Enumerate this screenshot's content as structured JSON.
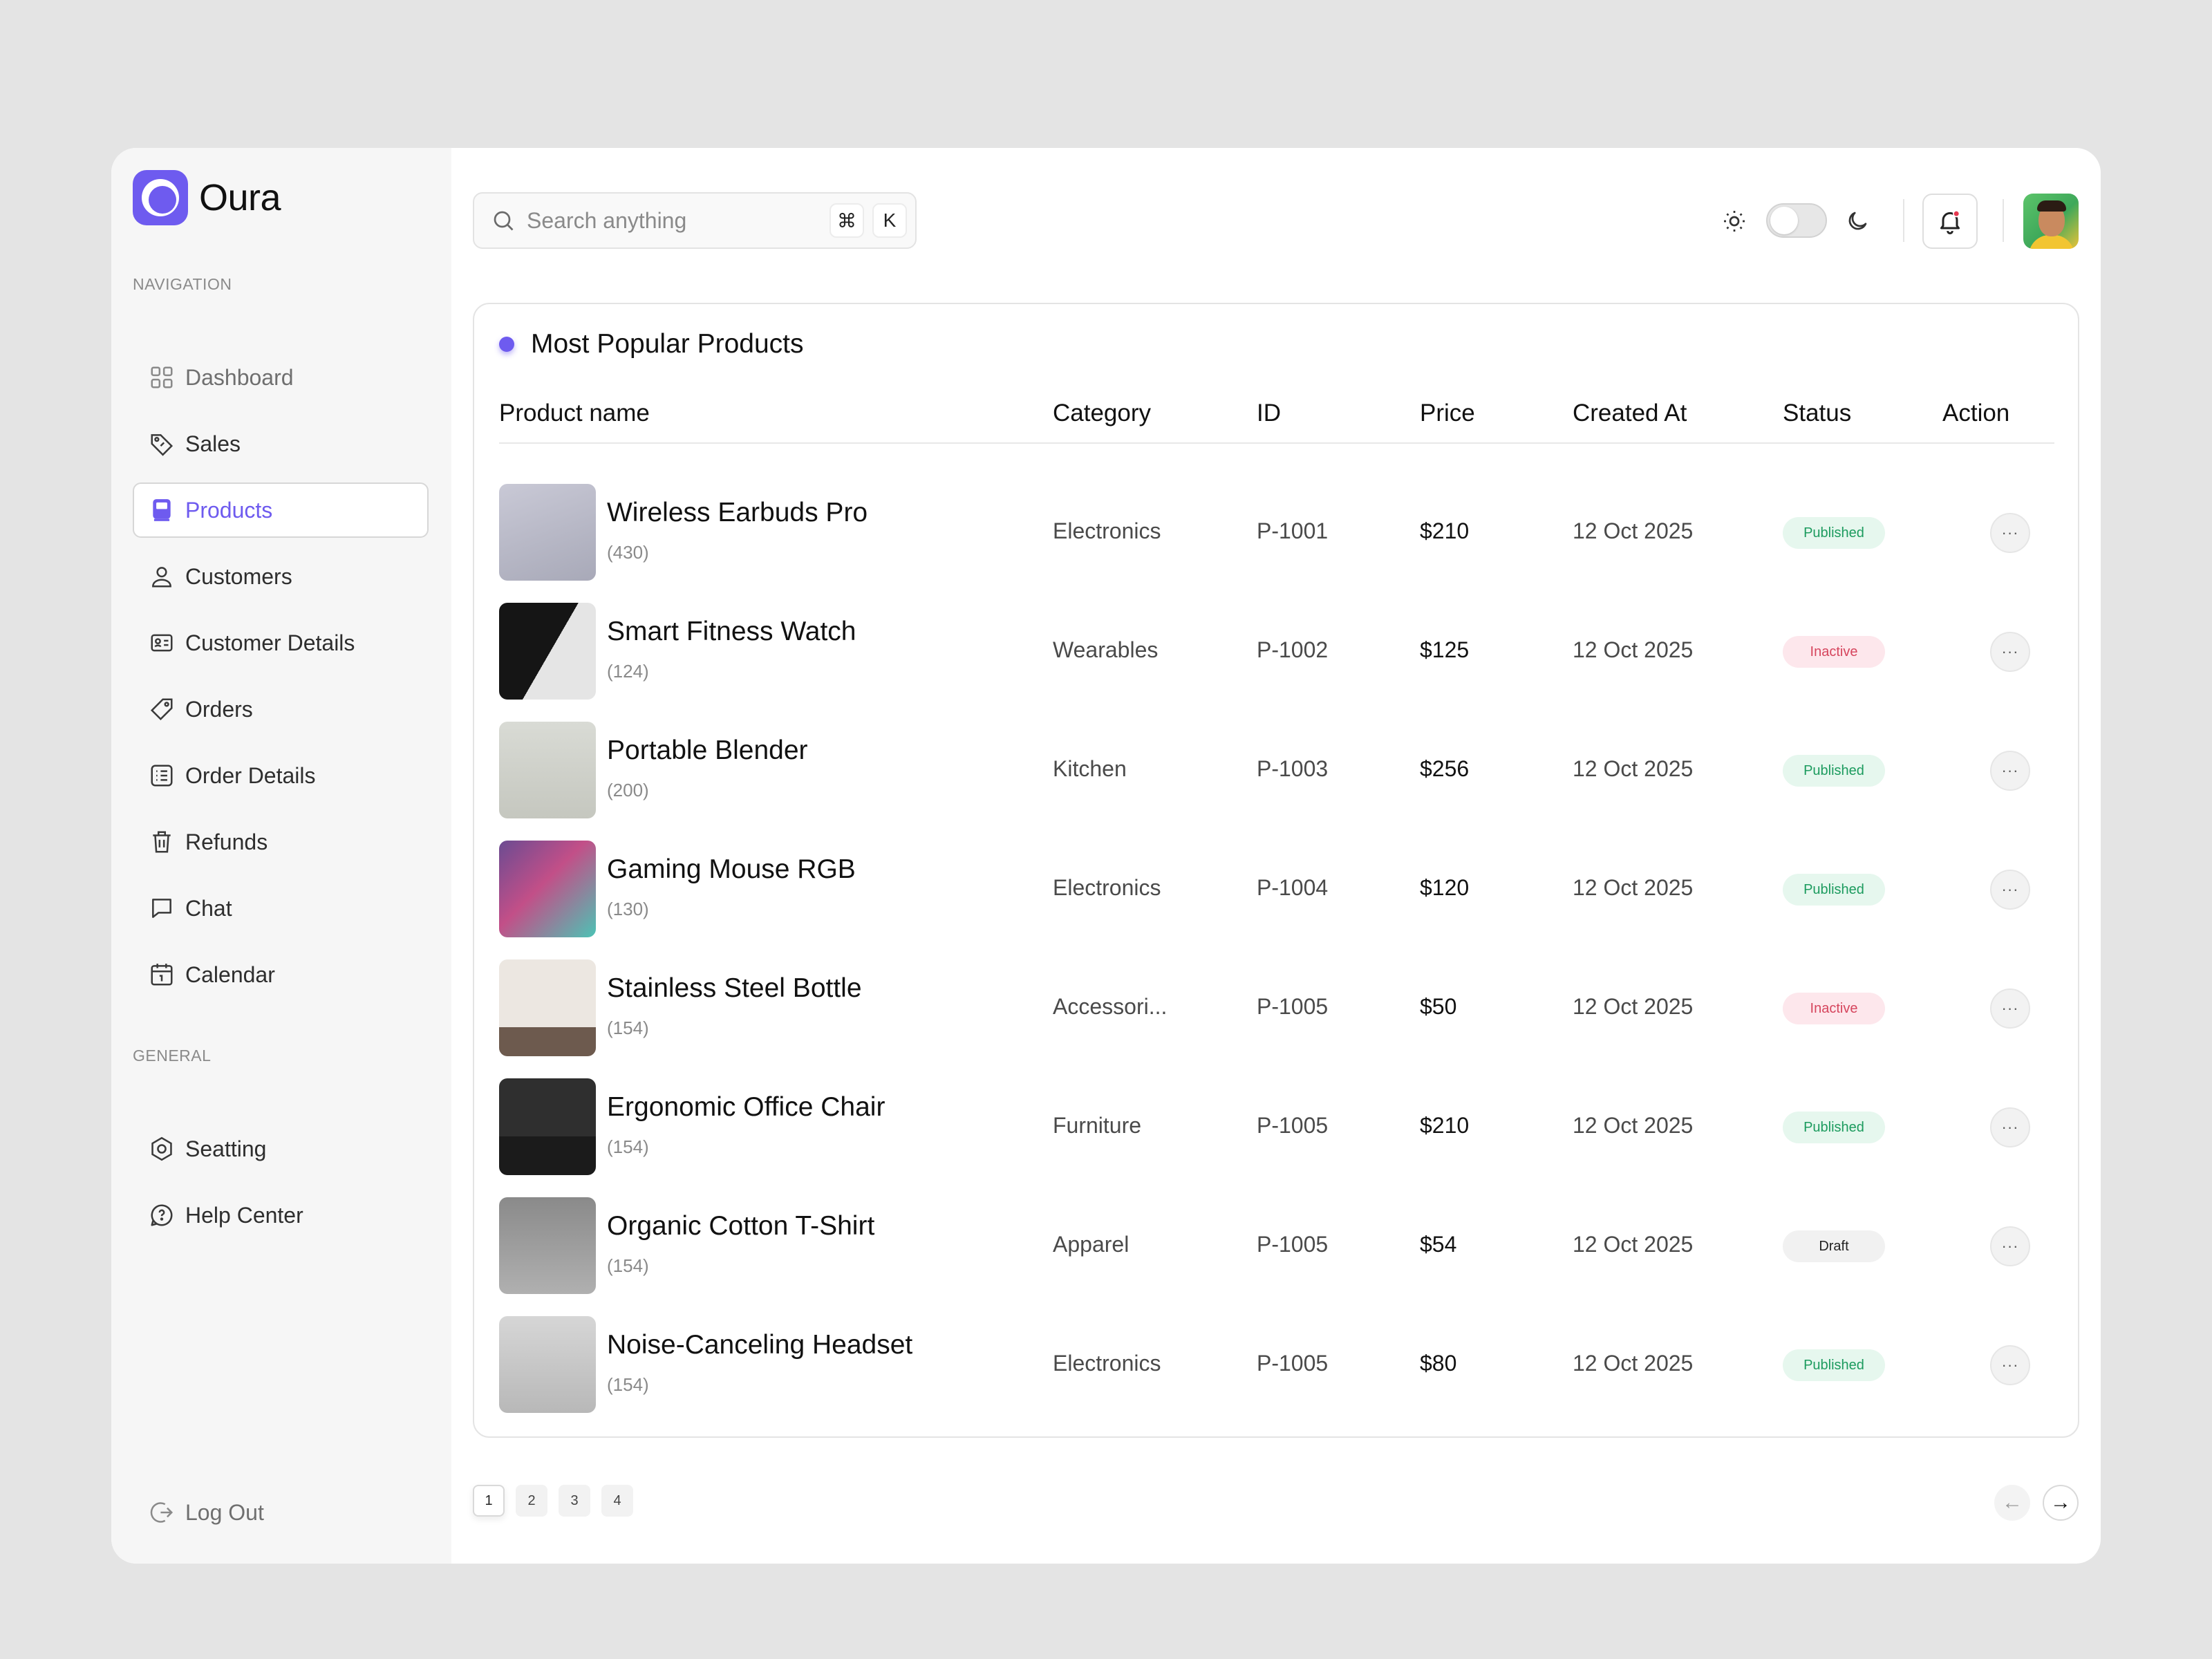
{
  "brand": {
    "name": "Oura"
  },
  "sidebar": {
    "navigation_label": "NAVIGATION",
    "general_label": "GENERAL",
    "items": [
      {
        "label": "Dashboard",
        "icon": "grid-icon"
      },
      {
        "label": "Sales",
        "icon": "tag-icon"
      },
      {
        "label": "Products",
        "icon": "box-icon",
        "active": true
      },
      {
        "label": "Customers",
        "icon": "user-icon"
      },
      {
        "label": "Customer Details",
        "icon": "id-card-icon"
      },
      {
        "label": "Orders",
        "icon": "tag-icon"
      },
      {
        "label": "Order Details",
        "icon": "list-icon"
      },
      {
        "label": "Refunds",
        "icon": "trash-icon"
      },
      {
        "label": "Chat",
        "icon": "chat-icon"
      },
      {
        "label": "Calendar",
        "icon": "calendar-icon"
      }
    ],
    "general": [
      {
        "label": "Seatting",
        "icon": "gear-icon"
      },
      {
        "label": "Help Center",
        "icon": "help-icon"
      }
    ],
    "logout_label": "Log Out"
  },
  "header": {
    "search_placeholder": "Search anything",
    "kbd_cmd": "⌘",
    "kbd_key": "K"
  },
  "card": {
    "title": "Most Popular Products",
    "columns": {
      "product": "Product name",
      "category": "Category",
      "id": "ID",
      "price": "Price",
      "created": "Created At",
      "status": "Status",
      "action": "Action"
    },
    "rows": [
      {
        "name": "Wireless Earbuds Pro",
        "count": "(430)",
        "category": "Electronics",
        "id": "P-1001",
        "price": "$210",
        "created": "12 Oct 2025",
        "status": "Published",
        "status_type": "published"
      },
      {
        "name": "Smart Fitness Watch",
        "count": "(124)",
        "category": "Wearables",
        "id": "P-1002",
        "price": "$125",
        "created": "12 Oct 2025",
        "status": "Inactive",
        "status_type": "inactive"
      },
      {
        "name": "Portable Blender",
        "count": "(200)",
        "category": "Kitchen",
        "id": "P-1003",
        "price": "$256",
        "created": "12 Oct 2025",
        "status": "Published",
        "status_type": "published"
      },
      {
        "name": "Gaming Mouse RGB",
        "count": "(130)",
        "category": "Electronics",
        "id": "P-1004",
        "price": "$120",
        "created": "12 Oct 2025",
        "status": "Published",
        "status_type": "published"
      },
      {
        "name": "Stainless Steel Bottle",
        "count": "(154)",
        "category": "Accessori...",
        "id": "P-1005",
        "price": "$50",
        "created": "12 Oct 2025",
        "status": "Inactive",
        "status_type": "inactive"
      },
      {
        "name": "Ergonomic Office Chair",
        "count": "(154)",
        "category": "Furniture",
        "id": "P-1005",
        "price": "$210",
        "created": "12 Oct 2025",
        "status": "Published",
        "status_type": "published"
      },
      {
        "name": "Organic Cotton T-Shirt",
        "count": "(154)",
        "category": "Apparel",
        "id": "P-1005",
        "price": "$54",
        "created": "12 Oct 2025",
        "status": "Draft",
        "status_type": "draft"
      },
      {
        "name": "Noise-Canceling Headset",
        "count": "(154)",
        "category": "Electronics",
        "id": "P-1005",
        "price": "$80",
        "created": "12 Oct 2025",
        "status": "Published",
        "status_type": "published"
      }
    ],
    "action_label": "···"
  },
  "pagination": {
    "pages": [
      "1",
      "2",
      "3",
      "4"
    ],
    "current": "1",
    "prev_label": "←",
    "next_label": "→"
  },
  "colors": {
    "accent": "#6e5bef",
    "published_bg": "#e6f7ee",
    "published_text": "#1c9b5e",
    "inactive_bg": "#fde7ec",
    "inactive_text": "#d6455d",
    "draft_bg": "#f1f1f1"
  }
}
